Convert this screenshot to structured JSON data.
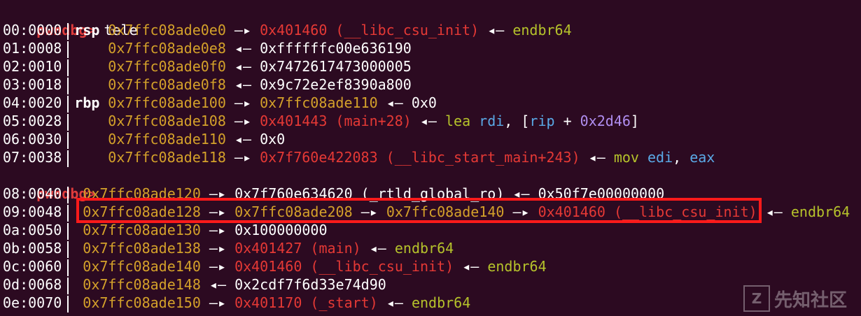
{
  "prompt1": "pwndbg>",
  "command": "tele",
  "prompt2": "pwndbg>",
  "arrow": "—▸",
  "back_arrow": "◂—",
  "block1": [
    {
      "idx": "00:0000",
      "reg": "rsp",
      "addr": "0x7ffc08ade0e0",
      "chain": [
        {
          "t": "arrow"
        },
        {
          "c": "code",
          "v": "0x401460 (__libc_csu_init)"
        },
        {
          "t": "back"
        },
        {
          "c": "inst",
          "v": "endbr64"
        }
      ]
    },
    {
      "idx": "01:0008",
      "reg": "",
      "addr": "0x7ffc08ade0e8",
      "chain": [
        {
          "t": "back"
        },
        {
          "c": "white",
          "v": "0xffffffc00e636190"
        }
      ]
    },
    {
      "idx": "02:0010",
      "reg": "",
      "addr": "0x7ffc08ade0f0",
      "chain": [
        {
          "t": "back"
        },
        {
          "c": "white",
          "v": "0x7472617473000005"
        }
      ]
    },
    {
      "idx": "03:0018",
      "reg": "",
      "addr": "0x7ffc08ade0f8",
      "chain": [
        {
          "t": "back"
        },
        {
          "c": "white",
          "v": "0x9c72e2ef8390a800"
        }
      ]
    },
    {
      "idx": "04:0020",
      "reg": "rbp",
      "addr": "0x7ffc08ade100",
      "chain": [
        {
          "t": "arrow"
        },
        {
          "c": "addr",
          "v": "0x7ffc08ade110"
        },
        {
          "t": "back"
        },
        {
          "c": "white",
          "v": "0x0"
        }
      ]
    },
    {
      "idx": "05:0028",
      "reg": "",
      "addr": "0x7ffc08ade108",
      "chain": [
        {
          "t": "arrow"
        },
        {
          "c": "code",
          "v": "0x401443 (main+28)"
        },
        {
          "t": "back"
        },
        {
          "c": "inst",
          "v": "lea "
        },
        {
          "c": "reg",
          "v": "rdi"
        },
        {
          "c": "white",
          "v": ", ["
        },
        {
          "c": "reg",
          "v": "rip"
        },
        {
          "c": "white",
          "v": " + "
        },
        {
          "c": "num",
          "v": "0x2d46"
        },
        {
          "c": "white",
          "v": "]"
        }
      ]
    },
    {
      "idx": "06:0030",
      "reg": "",
      "addr": "0x7ffc08ade110",
      "chain": [
        {
          "t": "back"
        },
        {
          "c": "white",
          "v": "0x0"
        }
      ]
    },
    {
      "idx": "07:0038",
      "reg": "",
      "addr": "0x7ffc08ade118",
      "chain": [
        {
          "t": "arrow"
        },
        {
          "c": "code",
          "v": "0x7f760e422083 (__libc_start_main+243)"
        },
        {
          "t": "back"
        },
        {
          "c": "inst",
          "v": "mov "
        },
        {
          "c": "reg",
          "v": "edi"
        },
        {
          "c": "white",
          "v": ", "
        },
        {
          "c": "reg",
          "v": "eax"
        }
      ]
    }
  ],
  "block2": [
    {
      "idx": "08:0040",
      "addr": "0x7ffc08ade120",
      "chain": [
        {
          "t": "arrow"
        },
        {
          "c": "white",
          "v": "0x7f760e634620 (_rtld_global_ro)"
        },
        {
          "t": "back"
        },
        {
          "c": "white",
          "v": "0x50f7e00000000"
        }
      ]
    },
    {
      "idx": "09:0048",
      "addr": "0x7ffc08ade128",
      "chain": [
        {
          "t": "arrow"
        },
        {
          "c": "addr",
          "v": "0x7ffc08ade208"
        },
        {
          "t": "arrow"
        },
        {
          "c": "addr",
          "v": "0x7ffc08ade140"
        },
        {
          "t": "arrow"
        },
        {
          "c": "code",
          "v": "0x401460 (__libc_csu_init)"
        },
        {
          "t": "back"
        },
        {
          "c": "inst",
          "v": "endbr64"
        }
      ]
    },
    {
      "idx": "0a:0050",
      "addr": "0x7ffc08ade130",
      "chain": [
        {
          "t": "arrow"
        },
        {
          "c": "white",
          "v": "0x100000000"
        }
      ]
    },
    {
      "idx": "0b:0058",
      "addr": "0x7ffc08ade138",
      "chain": [
        {
          "t": "arrow"
        },
        {
          "c": "code",
          "v": "0x401427 (main)"
        },
        {
          "t": "back"
        },
        {
          "c": "inst",
          "v": "endbr64"
        }
      ]
    },
    {
      "idx": "0c:0060",
      "addr": "0x7ffc08ade140",
      "chain": [
        {
          "t": "arrow"
        },
        {
          "c": "code",
          "v": "0x401460 (__libc_csu_init)"
        },
        {
          "t": "back"
        },
        {
          "c": "inst",
          "v": "endbr64"
        }
      ]
    },
    {
      "idx": "0d:0068",
      "addr": "0x7ffc08ade148",
      "chain": [
        {
          "t": "back"
        },
        {
          "c": "white",
          "v": "0x2cdf7f6d33e74d90"
        }
      ]
    },
    {
      "idx": "0e:0070",
      "addr": "0x7ffc08ade150",
      "chain": [
        {
          "t": "arrow"
        },
        {
          "c": "code",
          "v": "0x401170 (_start)"
        },
        {
          "t": "back"
        },
        {
          "c": "inst",
          "v": "endbr64"
        }
      ]
    }
  ],
  "watermark": {
    "text": "先知社区",
    "icon": "shield-logo-icon"
  }
}
